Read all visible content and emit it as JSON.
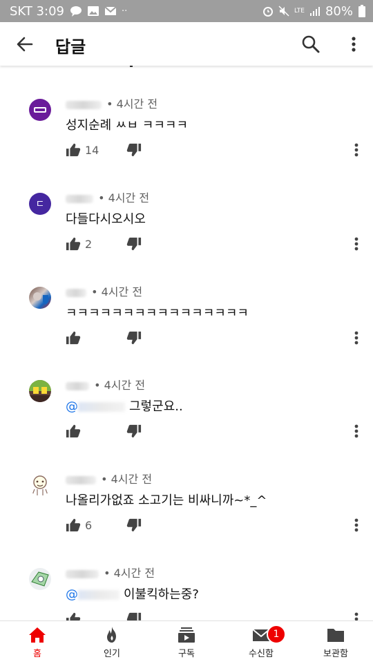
{
  "status_bar": {
    "carrier": "SKT 3:09",
    "lte": "LTE",
    "battery": "80%"
  },
  "app_bar": {
    "title": "답글"
  },
  "comments": [
    {
      "time": "• 4시간 전",
      "text": "성지순례 ㅆㅂ ㅋㅋㅋㅋ",
      "likes": "14",
      "avatar_color": "#6a1b9a"
    },
    {
      "time": "• 4시간 전",
      "text": "다들다시오시오",
      "likes": "2",
      "avatar_color": "#4527a0",
      "avatar_letter": "ㄷ"
    },
    {
      "time": "• 4시간 전",
      "text": "ㅋㅋㅋㅋㅋㅋㅋㅋㅋㅋㅋㅋㅋㅋㅋㅋ",
      "likes": ""
    },
    {
      "time": "• 4시간 전",
      "mention_prefix": "@",
      "text": "그렇군요..",
      "likes": ""
    },
    {
      "time": "• 4시간 전",
      "text": "나올리가없죠 소고기는 비싸니까~*_^",
      "likes": "6"
    },
    {
      "time": "• 4시간 전",
      "mention_prefix": "@",
      "text": "이불킥하는중?",
      "likes": ""
    }
  ],
  "bottom_nav": {
    "items": [
      {
        "label": "홈",
        "icon": "home-icon",
        "active": true
      },
      {
        "label": "인기",
        "icon": "fire-icon"
      },
      {
        "label": "구독",
        "icon": "subscriptions-icon"
      },
      {
        "label": "수신함",
        "icon": "mail-icon",
        "badge": "1"
      },
      {
        "label": "보관함",
        "icon": "folder-icon"
      }
    ]
  },
  "colors": {
    "accent": "#ff0000",
    "mention": "#1a73e8",
    "status_bar": "#9e9e9e"
  }
}
